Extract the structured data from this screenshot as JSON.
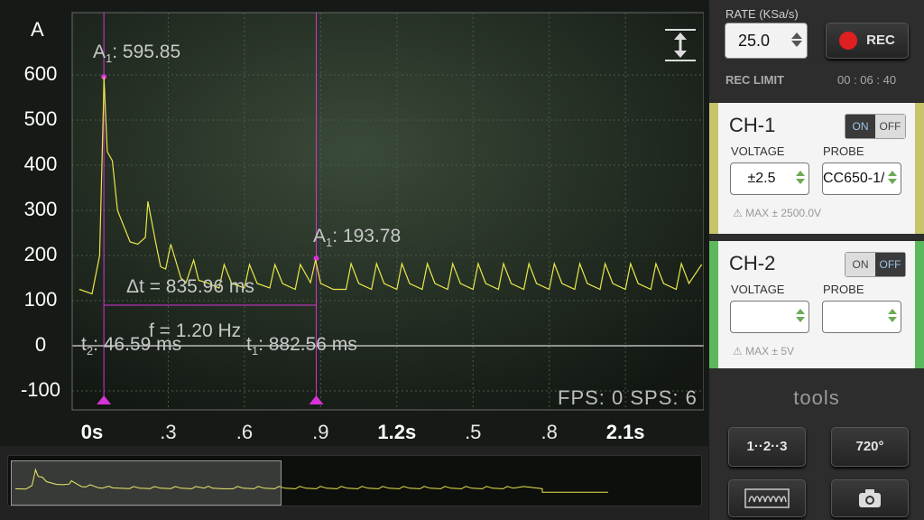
{
  "plot": {
    "unit": "A",
    "y_ticks": [
      "600",
      "500",
      "400",
      "300",
      "200",
      "100",
      "0",
      "-100"
    ],
    "x_ticks": [
      {
        "label": "0s",
        "major": true,
        "t": 0
      },
      {
        "label": ".3",
        "major": false,
        "t": 0.3
      },
      {
        "label": ".6",
        "major": false,
        "t": 0.6
      },
      {
        "label": ".9",
        "major": false,
        "t": 0.9
      },
      {
        "label": "1.2s",
        "major": true,
        "t": 1.2
      },
      {
        "label": ".5",
        "major": false,
        "t": 1.5
      },
      {
        "label": ".8",
        "major": false,
        "t": 1.8
      },
      {
        "label": "2.1s",
        "major": true,
        "t": 2.1
      }
    ],
    "marker1_label": "A",
    "marker1_sub": "1",
    "marker1_value": ": 595.85",
    "marker2_label": "A",
    "marker2_sub": "1",
    "marker2_value": ": 193.78",
    "delta_t": "Δt = 835.96 ms",
    "freq": "f = 1.20 Hz",
    "t2_label": "t",
    "t2_sub": "2",
    "t2_value": ": 46.59 ms",
    "t1_label": "t",
    "t1_sub": "1",
    "t1_value": ": 882.56 ms",
    "fps": "FPS: 0  SPS: 6",
    "trace_color": "#e8e84a",
    "cursor_color": "#d633d6"
  },
  "chart_data": {
    "type": "line",
    "xlabel": "",
    "ylabel": "A",
    "xlim": [
      -0.1,
      2.5
    ],
    "ylim": [
      -120,
      650
    ],
    "cursors": [
      {
        "t": 0.0466,
        "value": 595.85
      },
      {
        "t": 0.8826,
        "value": 193.78
      }
    ],
    "series": [
      {
        "x": [
          -0.05,
          0,
          0.03,
          0.045,
          0.047,
          0.06,
          0.08,
          0.1,
          0.15,
          0.18,
          0.21,
          0.22,
          0.25,
          0.27,
          0.29,
          0.31,
          0.35,
          0.37,
          0.4,
          0.42,
          0.45,
          0.5,
          0.52,
          0.55,
          0.6,
          0.62,
          0.65,
          0.7,
          0.72,
          0.75,
          0.8,
          0.82,
          0.86,
          0.88,
          0.9,
          0.95,
          1.0,
          1.02,
          1.05,
          1.1,
          1.12,
          1.15,
          1.2,
          1.22,
          1.25,
          1.3,
          1.32,
          1.35,
          1.4,
          1.42,
          1.45,
          1.5,
          1.52,
          1.55,
          1.6,
          1.62,
          1.65,
          1.7,
          1.72,
          1.75,
          1.8,
          1.82,
          1.85,
          1.9,
          1.92,
          1.95,
          2.0,
          2.02,
          2.05,
          2.1,
          2.12,
          2.15,
          2.2,
          2.22,
          2.25,
          2.3,
          2.32,
          2.35,
          2.4
        ],
        "y": [
          125,
          115,
          200,
          540,
          596,
          430,
          410,
          300,
          230,
          225,
          240,
          320,
          230,
          175,
          170,
          225,
          150,
          140,
          190,
          145,
          140,
          128,
          180,
          138,
          128,
          180,
          138,
          128,
          180,
          138,
          125,
          180,
          140,
          190,
          138,
          125,
          125,
          182,
          138,
          125,
          182,
          138,
          125,
          182,
          138,
          125,
          182,
          138,
          125,
          182,
          138,
          125,
          182,
          138,
          125,
          182,
          138,
          125,
          182,
          138,
          125,
          182,
          138,
          125,
          182,
          138,
          125,
          182,
          138,
          125,
          182,
          138,
          125,
          182,
          138,
          125,
          182,
          138,
          180
        ]
      }
    ]
  },
  "overview": {
    "trace_color": "#e8e84a"
  },
  "panel": {
    "rate_label": "RATE (KSa/s)",
    "rate_value": "25.0",
    "rec_label": "REC",
    "rec_limit_label": "REC LIMIT",
    "rec_time": "00 : 06 : 40",
    "ch1": {
      "title": "CH-1",
      "on": "ON",
      "off": "OFF",
      "voltage_label": "VOLTAGE",
      "probe_label": "PROBE",
      "voltage_value": "±2.5",
      "probe_value": "CC650-1/",
      "max_text": "MAX ± 2500.0V",
      "color": "#c8c46a"
    },
    "ch2": {
      "title": "CH-2",
      "on": "ON",
      "off": "OFF",
      "voltage_label": "VOLTAGE",
      "probe_label": "PROBE",
      "voltage_value": "",
      "probe_value": "",
      "max_text": "MAX ± 5V",
      "color": "#5cb85c"
    },
    "tools_label": "tools",
    "btn_channels": "1··2··3",
    "btn_720": "720°"
  }
}
